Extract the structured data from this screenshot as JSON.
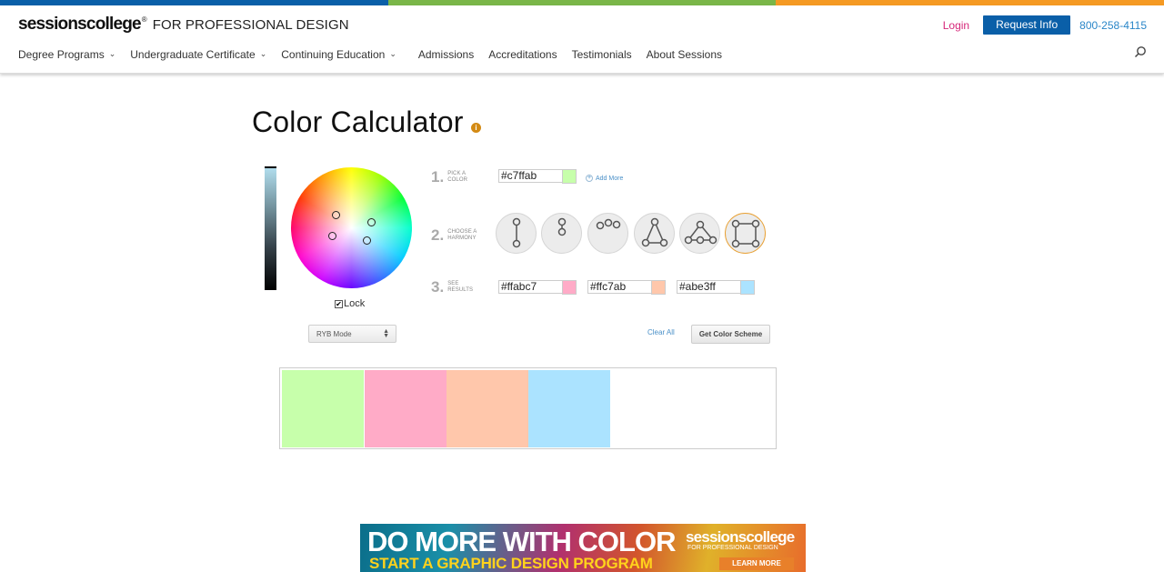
{
  "topbar": {
    "colors": [
      "#0a5fa8",
      "#7ab648",
      "#f59a23"
    ]
  },
  "header": {
    "logo_brand": "sessionscollege",
    "logo_reg": "®",
    "logo_tagline": "FOR PROFESSIONAL DESIGN",
    "login": "Login",
    "request_info": "Request Info",
    "phone": "800-258-4115",
    "nav": [
      {
        "label": "Degree Programs",
        "dropdown": true
      },
      {
        "label": "Undergraduate Certificate",
        "dropdown": true
      },
      {
        "label": "Continuing Education",
        "dropdown": true
      },
      {
        "label": "Admissions",
        "dropdown": false
      },
      {
        "label": "Accreditations",
        "dropdown": false
      },
      {
        "label": "Testimonials",
        "dropdown": false
      },
      {
        "label": "About Sessions",
        "dropdown": false
      }
    ],
    "search_icon": "search-icon"
  },
  "page": {
    "title": "Color Calculator",
    "info_icon": "i"
  },
  "calculator": {
    "lock_label": "Lock",
    "lock_checked": true,
    "mode": "RYB Mode",
    "step1": {
      "num": "1.",
      "label_line1": "PICK A",
      "label_line2": "COLOR"
    },
    "step2": {
      "num": "2.",
      "label_line1": "CHOOSE A",
      "label_line2": "HARMONY"
    },
    "step3": {
      "num": "3.",
      "label_line1": "SEE",
      "label_line2": "RESULTS"
    },
    "base_color": {
      "hex": "#c7ffab",
      "swatch": "#c7ffab"
    },
    "add_more": "Add More",
    "harmonies": [
      "complementary",
      "split-complementary",
      "analogous",
      "triad",
      "triangle",
      "square"
    ],
    "selected_harmony": "square",
    "results": [
      {
        "hex": "#ffabc7",
        "swatch": "#ffabc7"
      },
      {
        "hex": "#ffc7ab",
        "swatch": "#ffc7ab"
      },
      {
        "hex": "#abe3ff",
        "swatch": "#abe3ff"
      }
    ],
    "clear_all": "Clear All",
    "get_scheme": "Get Color Scheme"
  },
  "scheme_blocks": [
    "#c7ffab",
    "#ffabc7",
    "#ffc7ab",
    "#abe3ff"
  ],
  "banner": {
    "line1": "DO MORE WITH COLOR",
    "line2": "START A GRAPHIC DESIGN PROGRAM",
    "logo": "sessionscollege",
    "tagline": "FOR PROFESSIONAL DESIGN",
    "cta": "LEARN MORE"
  }
}
